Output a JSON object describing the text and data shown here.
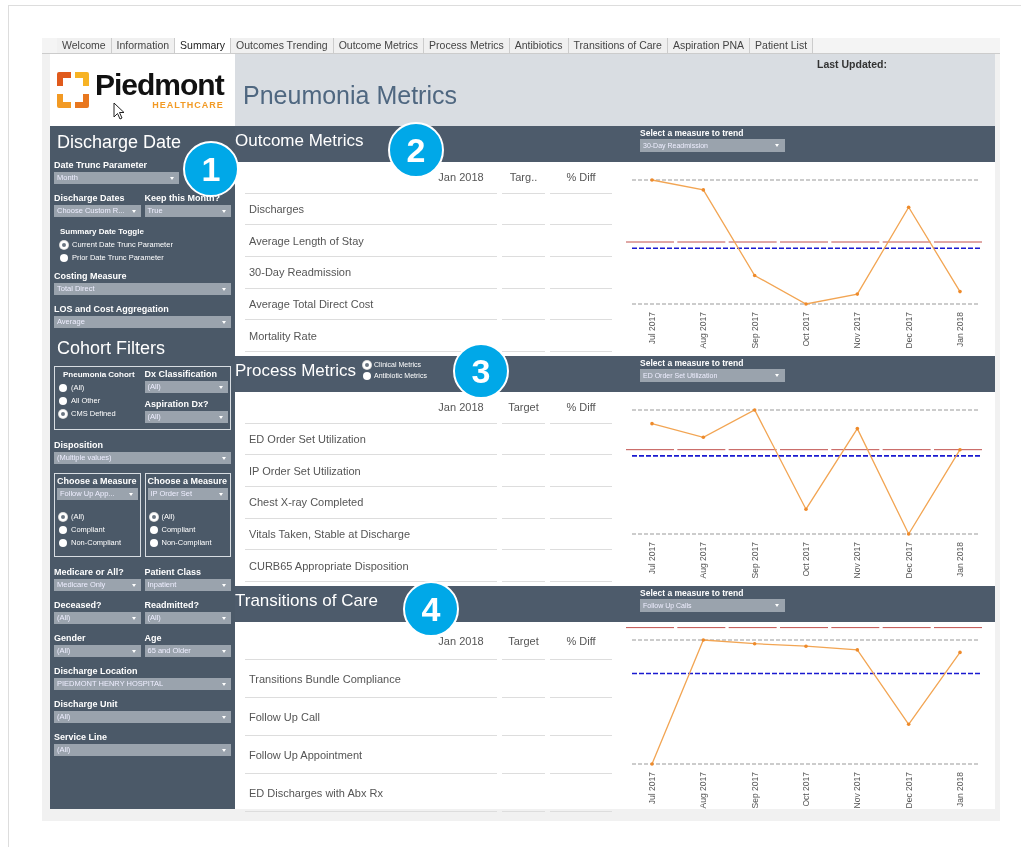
{
  "tabs": [
    {
      "label": "Welcome",
      "selected": false
    },
    {
      "label": "Information",
      "selected": false
    },
    {
      "label": "Summary",
      "selected": true
    },
    {
      "label": "Outcomes Trending",
      "selected": false
    },
    {
      "label": "Outcome Metrics",
      "selected": false
    },
    {
      "label": "Process Metrics",
      "selected": false
    },
    {
      "label": "Antibiotics",
      "selected": false
    },
    {
      "label": "Transitions of Care",
      "selected": false
    },
    {
      "label": "Aspiration PNA",
      "selected": false
    },
    {
      "label": "Patient List",
      "selected": false
    }
  ],
  "logo": {
    "name": "Piedmont",
    "tagline": "HEALTHCARE"
  },
  "header": {
    "title": "Pneumonia Metrics",
    "last_updated_label": "Last Updated:"
  },
  "sidebar": {
    "callout": "1",
    "blocks": [
      {
        "kind": "heading",
        "text": "Discharge Date"
      },
      {
        "kind": "dropdown",
        "label": "Date Trunc Parameter",
        "value": "Month"
      },
      {
        "kind": "columns",
        "children": [
          {
            "kind": "dropdown",
            "label": "Discharge Dates",
            "value": "Choose Custom R..."
          },
          {
            "kind": "dropdown",
            "label": "Keep this Month?",
            "value": "True"
          }
        ]
      },
      {
        "kind": "radios",
        "label": "Summary Date Toggle",
        "options": [
          {
            "label": "Current Date Trunc Parameter",
            "selected": true
          },
          {
            "label": "Prior Date Trunc Parameter",
            "selected": false
          }
        ]
      },
      {
        "kind": "dropdown",
        "label": "Costing Measure",
        "value": "Total Direct"
      },
      {
        "kind": "dropdown",
        "label": "LOS and Cost Aggregation",
        "value": "Average"
      },
      {
        "kind": "heading",
        "text": "Cohort Filters"
      },
      {
        "kind": "box",
        "children": [
          {
            "kind": "columns",
            "children": [
              {
                "kind": "radios",
                "label": "Pneumonia Cohort",
                "options": [
                  {
                    "label": "(All)",
                    "selected": false
                  },
                  {
                    "label": "All Other",
                    "selected": false
                  },
                  {
                    "label": "CMS Defined",
                    "selected": true
                  }
                ]
              },
              {
                "kind": "stack",
                "children": [
                  {
                    "kind": "dropdown",
                    "label": "Dx Classification",
                    "value": "(All)"
                  },
                  {
                    "kind": "dropdown",
                    "label": "Aspiration Dx?",
                    "value": "(All)"
                  }
                ]
              }
            ]
          }
        ]
      },
      {
        "kind": "dropdown",
        "label": "Disposition",
        "value": "(Multiple values)"
      },
      {
        "kind": "columns",
        "children": [
          {
            "kind": "box",
            "children": [
              {
                "kind": "dropdown",
                "label": "Choose a Measure",
                "value": "Follow Up App..."
              },
              {
                "kind": "radios",
                "options": [
                  {
                    "label": "(All)",
                    "selected": true
                  },
                  {
                    "label": "Compliant",
                    "selected": false
                  },
                  {
                    "label": "Non-Compliant",
                    "selected": false
                  }
                ]
              }
            ]
          },
          {
            "kind": "box",
            "children": [
              {
                "kind": "dropdown",
                "label": "Choose a Measure",
                "value": "IP Order Set"
              },
              {
                "kind": "radios",
                "options": [
                  {
                    "label": "(All)",
                    "selected": true
                  },
                  {
                    "label": "Compliant",
                    "selected": false
                  },
                  {
                    "label": "Non-Compliant",
                    "selected": false
                  }
                ]
              }
            ]
          }
        ]
      },
      {
        "kind": "columns",
        "children": [
          {
            "kind": "dropdown",
            "label": "Medicare or All?",
            "value": "Medicare Only"
          },
          {
            "kind": "dropdown",
            "label": "Patient Class",
            "value": "Inpatient"
          }
        ]
      },
      {
        "kind": "columns",
        "children": [
          {
            "kind": "dropdown",
            "label": "Deceased?",
            "value": "(All)"
          },
          {
            "kind": "dropdown",
            "label": "Readmitted?",
            "value": "(All)"
          }
        ]
      },
      {
        "kind": "columns",
        "children": [
          {
            "kind": "dropdown",
            "label": "Gender",
            "value": "(All)"
          },
          {
            "kind": "dropdown",
            "label": "Age",
            "value": "65 and Older"
          }
        ]
      },
      {
        "kind": "dropdown",
        "label": "Discharge Location",
        "value": "PIEDMONT HENRY HOSPITAL"
      },
      {
        "kind": "dropdown",
        "label": "Discharge Unit",
        "value": "(All)"
      },
      {
        "kind": "dropdown",
        "label": "Service Line",
        "value": "(All)"
      }
    ]
  },
  "sections": [
    {
      "title": "Outcome Metrics",
      "callout": "2",
      "trend": {
        "label": "Select a measure to trend",
        "value": "30-Day Readmission",
        "months": [
          "Jul 2017",
          "Aug 2017",
          "Sep 2017",
          "Oct 2017",
          "Nov 2017",
          "Dec 2017",
          "Jan 2018"
        ]
      },
      "table": {
        "columns": [
          "Jan 2018",
          "Targ..",
          "% Diff"
        ],
        "rows": [
          "Discharges",
          "Average Length of Stay",
          "30-Day Readmission",
          "Average Total Direct Cost",
          "Mortality Rate"
        ]
      }
    },
    {
      "title": "Process Metrics",
      "callout": "3",
      "radios": {
        "options": [
          {
            "label": "Clinical Metrics",
            "selected": true
          },
          {
            "label": "Antibiotic Metrics",
            "selected": false
          }
        ]
      },
      "trend": {
        "label": "Select a measure to trend",
        "value": "ED Order Set Utilization",
        "months": [
          "Jul 2017",
          "Aug 2017",
          "Sep 2017",
          "Oct 2017",
          "Nov 2017",
          "Dec 2017",
          "Jan 2018"
        ]
      },
      "table": {
        "columns": [
          "Jan 2018",
          "Target",
          "% Diff"
        ],
        "rows": [
          "ED Order Set Utilization",
          "IP Order Set Utilization",
          "Chest X-ray Completed",
          "Vitals Taken, Stable at Discharge",
          "CURB65 Appropriate Disposition"
        ]
      }
    },
    {
      "title": "Transitions of Care",
      "callout": "4",
      "trend": {
        "label": "Select a measure to trend",
        "value": "Follow Up Calls",
        "months": [
          "Jul 2017",
          "Aug 2017",
          "Sep 2017",
          "Oct 2017",
          "Nov 2017",
          "Dec 2017",
          "Jan 2018"
        ]
      },
      "table": {
        "columns": [
          "Jan 2018",
          "Target",
          "% Diff"
        ],
        "rows": [
          "Transitions Bundle Compliance",
          "Follow Up Call",
          "Follow Up Appointment",
          "ED Discharges with Abx Rx"
        ]
      }
    }
  ]
}
